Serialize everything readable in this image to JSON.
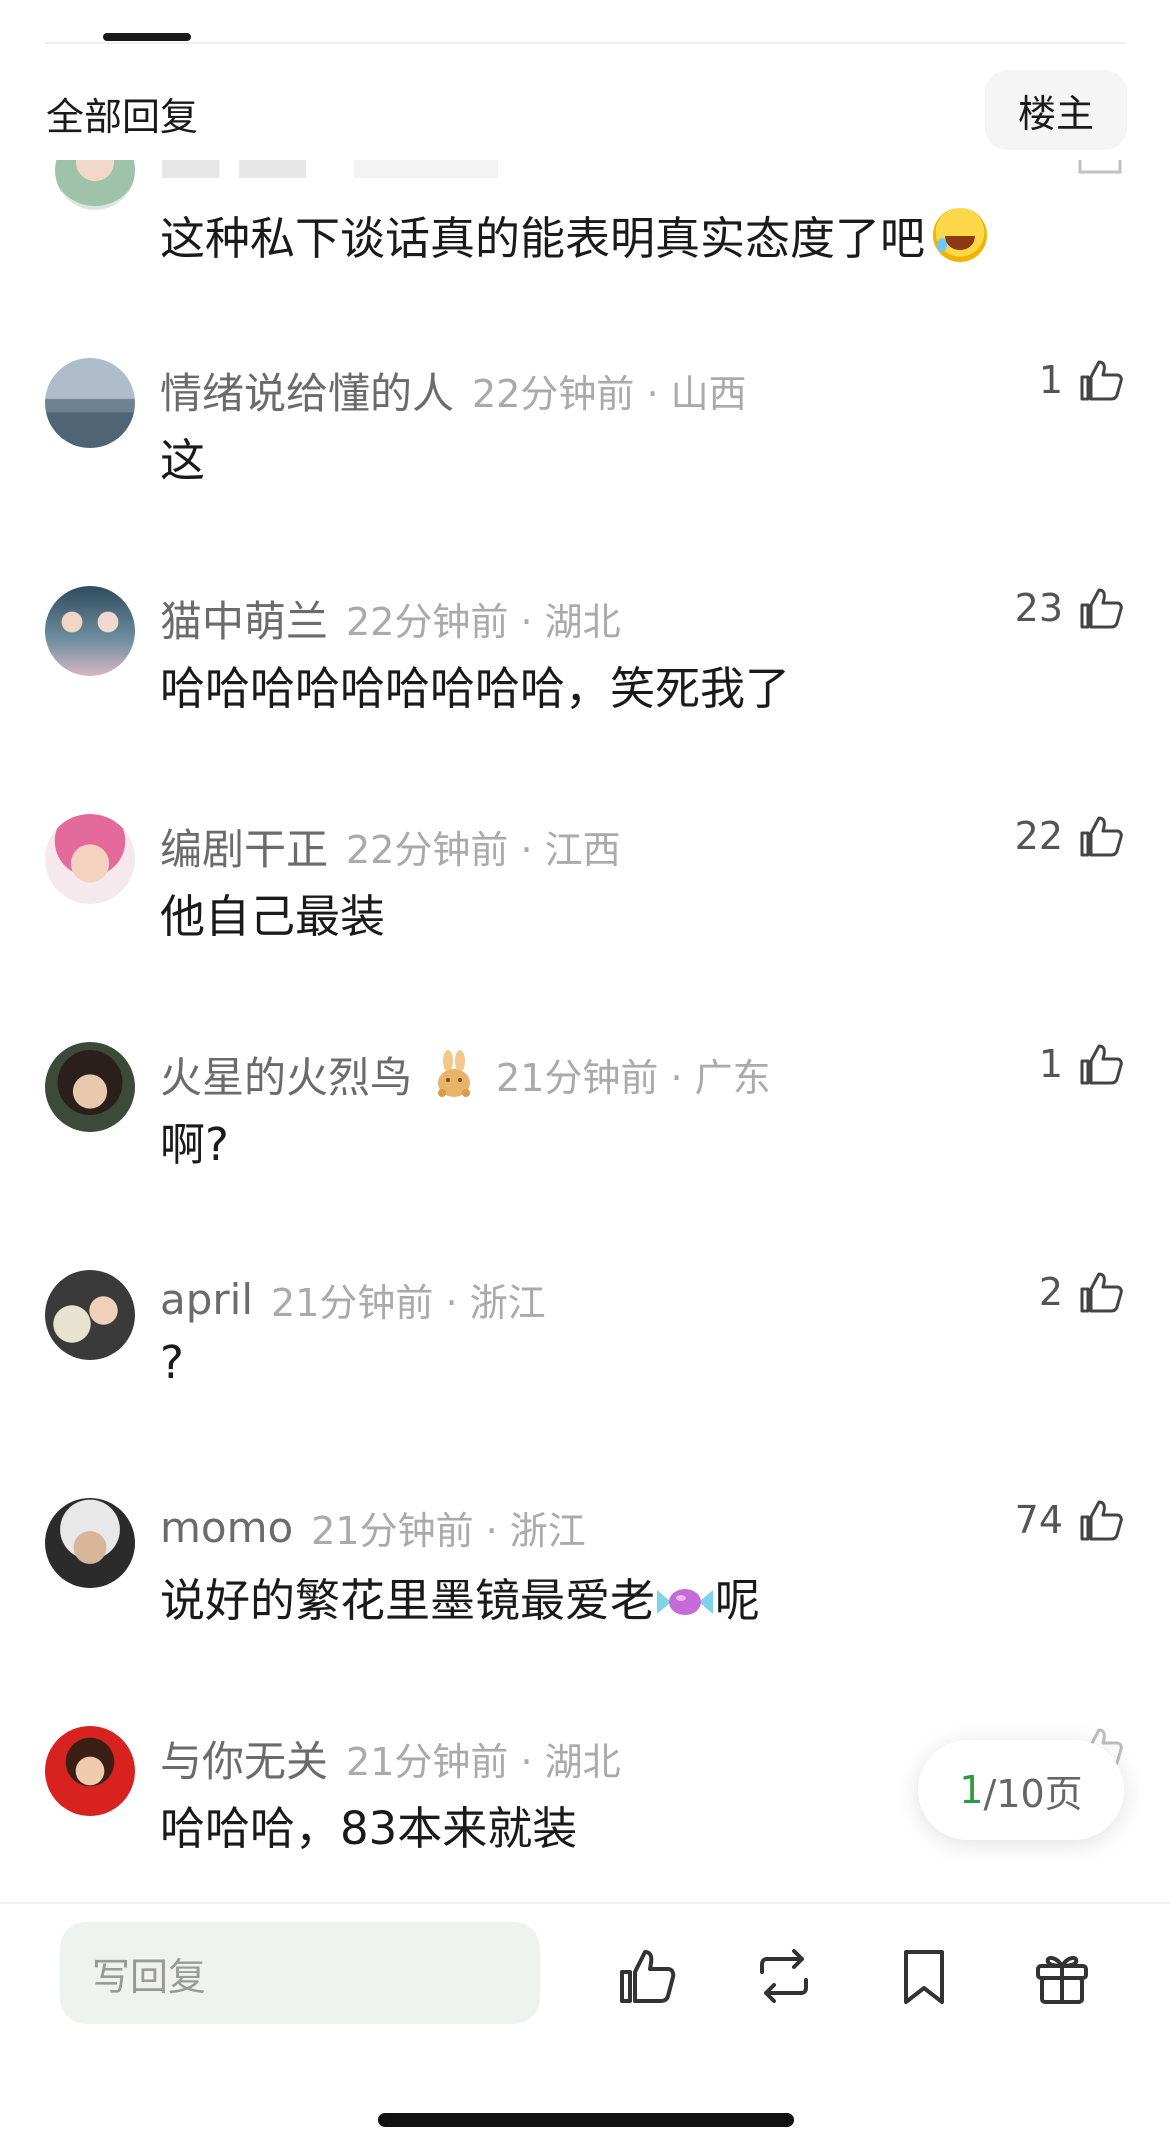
{
  "header": {
    "title": "全部回复",
    "op_label": "楼主"
  },
  "partial_comment": {
    "text": "这种私下谈话真的能表明真实态度了吧",
    "emoji_icon": "rolling-laughing-emoji"
  },
  "comments": [
    {
      "name": "情绪说给懂的人",
      "time": "22分钟前 · 山西",
      "likes": "1",
      "text": "这",
      "badge": ""
    },
    {
      "name": "猫中萌兰",
      "time": "22分钟前 · 湖北",
      "likes": "23",
      "text": "哈哈哈哈哈哈哈哈哈，笑死我了",
      "badge": ""
    },
    {
      "name": "编剧干正",
      "time": "22分钟前 · 江西",
      "likes": "22",
      "text": "他自己最装",
      "badge": ""
    },
    {
      "name": "火星的火烈鸟",
      "time": "21分钟前 · 广东",
      "likes": "1",
      "text": "啊?",
      "badge": "rabbit-badge-icon"
    },
    {
      "name": "april",
      "time": "21分钟前 · 浙江",
      "likes": "2",
      "text": "?",
      "badge": ""
    },
    {
      "name": "momo",
      "time": "21分钟前 · 浙江",
      "likes": "74",
      "text_before": "说好的繁花里墨镜最爱老",
      "text_after": "呢",
      "emoji_icon": "candy-emoji",
      "badge": ""
    },
    {
      "name": "与你无关",
      "time": "21分钟前 · 湖北",
      "likes": "",
      "text": "哈哈哈，83本来就装",
      "badge": ""
    }
  ],
  "pager": {
    "current": "1",
    "total_text": "/10页"
  },
  "bottom_bar": {
    "reply_placeholder": "写回复",
    "actions": [
      "thumb-up-icon",
      "repost-icon",
      "bookmark-icon",
      "gift-icon"
    ]
  },
  "colors": {
    "accent": "#2e9b3e",
    "meta_text": "#aaaaaa",
    "name_text": "#6b6b6b",
    "input_bg": "#eef3ef"
  }
}
